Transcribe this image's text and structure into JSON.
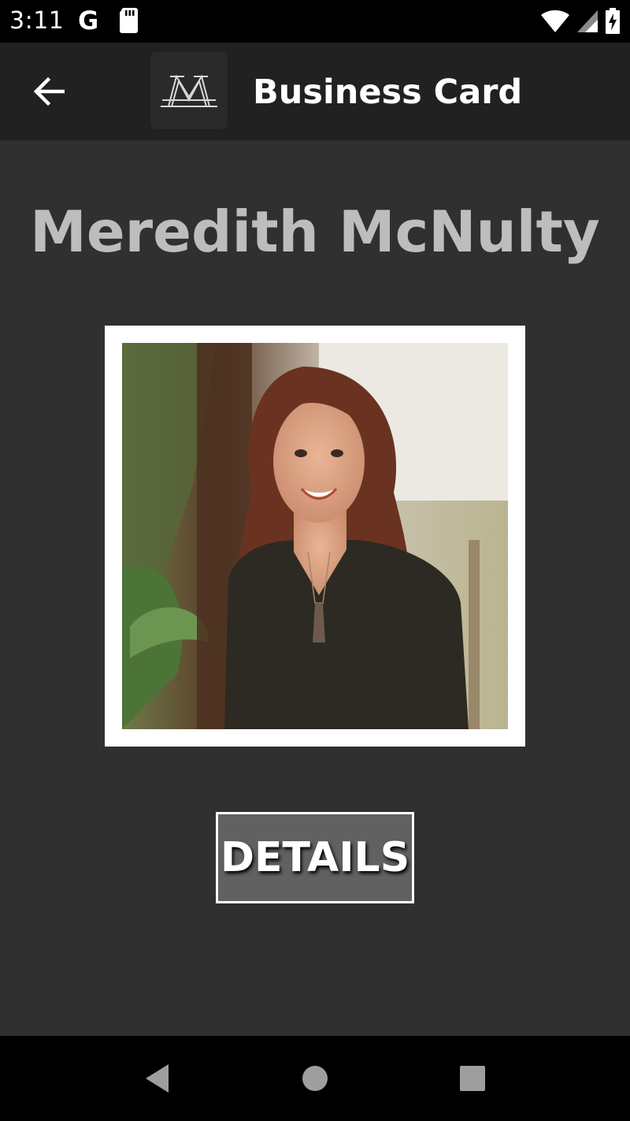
{
  "status_bar": {
    "time": "3:11",
    "google_indicator": "G",
    "icons": [
      "sd-card-icon",
      "wifi-icon",
      "cell-signal-icon",
      "battery-charging-icon"
    ]
  },
  "app_bar": {
    "title": "Business Card",
    "back_icon": "arrow-back-icon",
    "logo_icon": "m-logo-icon"
  },
  "card": {
    "name": "Meredith McNulty",
    "photo_alt": "portrait-photo",
    "details_button": "DETAILS"
  },
  "nav_bar": {
    "icons": [
      "nav-back-icon",
      "nav-home-icon",
      "nav-recents-icon"
    ]
  },
  "colors": {
    "background": "#303030",
    "app_bar": "#212121",
    "name_text": "#bdbdbd",
    "button_bg": "#616161",
    "frame": "#ffffff"
  }
}
